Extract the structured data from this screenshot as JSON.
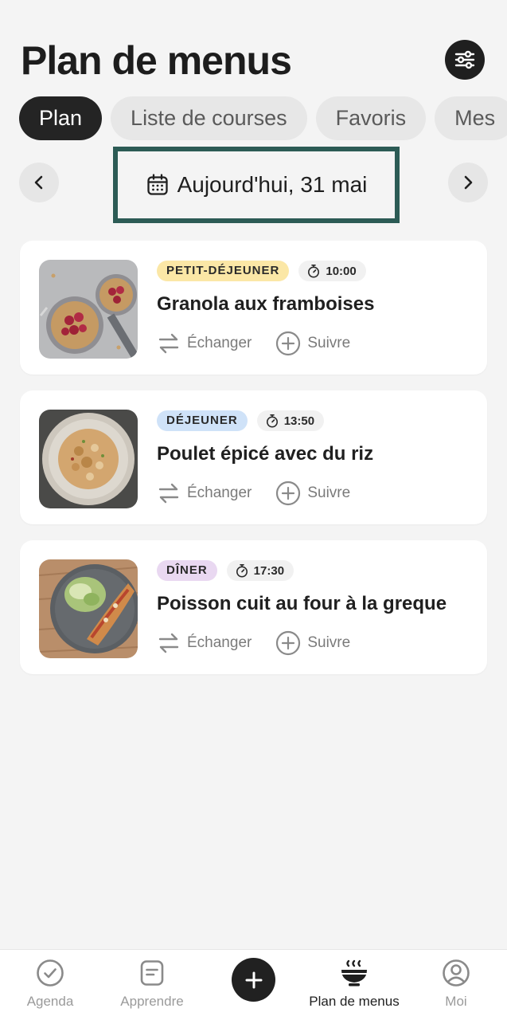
{
  "page": {
    "title": "Plan de menus"
  },
  "tabs": [
    {
      "label": "Plan",
      "active": true
    },
    {
      "label": "Liste de courses",
      "active": false
    },
    {
      "label": "Favoris",
      "active": false
    },
    {
      "label": "Mes",
      "active": false
    }
  ],
  "date": {
    "label": "Aujourd'hui, 31 mai"
  },
  "meals": [
    {
      "tag": "PETIT-DÉJEUNER",
      "tag_color": "#fbe7a6",
      "time": "10:00",
      "title": "Granola aux framboises",
      "swap": "Échanger",
      "follow": "Suivre"
    },
    {
      "tag": "DÉJEUNER",
      "tag_color": "#cfe2f8",
      "time": "13:50",
      "title": "Poulet épicé avec du riz",
      "swap": "Échanger",
      "follow": "Suivre"
    },
    {
      "tag": "DÎNER",
      "tag_color": "#e9d8f1",
      "time": "17:30",
      "title": "Poisson cuit au four à la greque",
      "swap": "Échanger",
      "follow": "Suivre"
    }
  ],
  "bottom_nav": [
    {
      "label": "Agenda",
      "icon": "check-circle-icon",
      "active": false
    },
    {
      "label": "Apprendre",
      "icon": "book-icon",
      "active": false
    },
    {
      "label": "Plan de menus",
      "icon": "steaming-bowl-icon",
      "active": true
    },
    {
      "label": "Moi",
      "icon": "user-circle-icon",
      "active": false
    }
  ],
  "colors": {
    "accent": "#2c5b55",
    "dark": "#212121",
    "background": "#f4f4f4"
  }
}
